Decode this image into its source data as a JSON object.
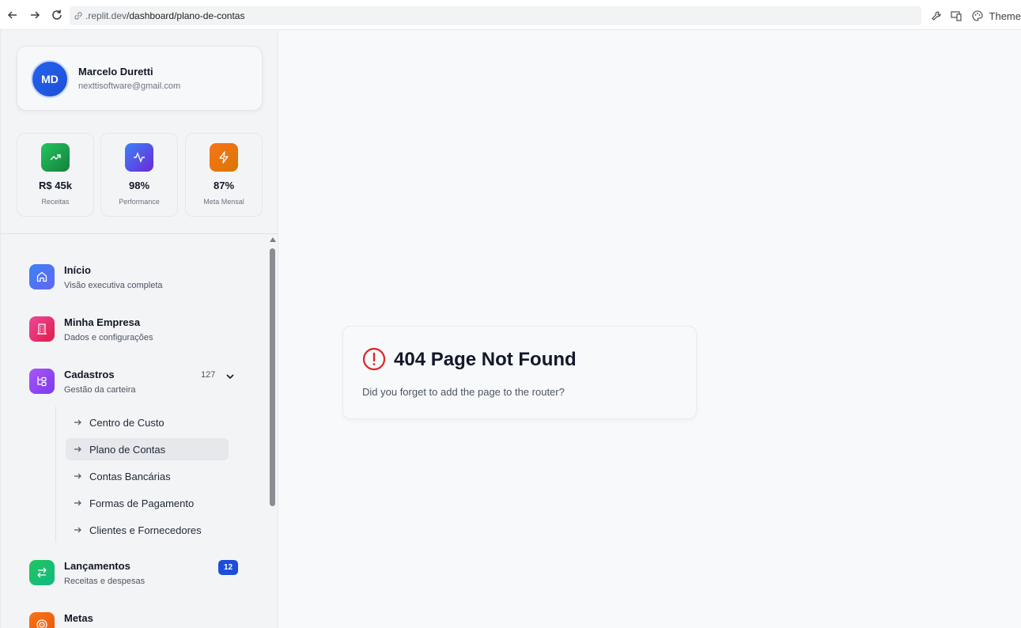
{
  "browser": {
    "url_domain": ".replit.dev",
    "url_path": "/dashboard/plano-de-contas",
    "theme_label": "Theme"
  },
  "profile": {
    "initials": "MD",
    "name": "Marcelo Duretti",
    "email": "nexttisoftware@gmail.com"
  },
  "stats": [
    {
      "value": "R$ 45k",
      "label": "Receitas",
      "icon": "trending-up-icon",
      "color": "#16a34a"
    },
    {
      "value": "98%",
      "label": "Performance",
      "icon": "activity-icon",
      "color": "#4f46e5"
    },
    {
      "value": "87%",
      "label": "Meta Mensal",
      "icon": "zap-icon",
      "color": "#ea580c"
    }
  ],
  "menu": {
    "inicio": {
      "title": "Início",
      "subtitle": "Visão executiva completa",
      "icon": "home-icon",
      "color": "#3b82f6"
    },
    "empresa": {
      "title": "Minha Empresa",
      "subtitle": "Dados e configurações",
      "icon": "building-icon",
      "color": "#ec4899"
    },
    "cadastros": {
      "title": "Cadastros",
      "subtitle": "Gestão da carteira",
      "count": "127",
      "icon": "tree-icon",
      "color": "#a855f7"
    },
    "lancamentos": {
      "title": "Lançamentos",
      "subtitle": "Receitas e despesas",
      "badge": "12",
      "icon": "swap-icon",
      "color": "#22c55e"
    },
    "metas": {
      "title": "Metas",
      "icon": "target-icon",
      "color": "#f97316"
    }
  },
  "submenu": [
    {
      "label": "Centro de Custo"
    },
    {
      "label": "Plano de Contas",
      "active": true
    },
    {
      "label": "Contas Bancárias"
    },
    {
      "label": "Formas de Pagamento"
    },
    {
      "label": "Clientes e Fornecedores"
    }
  ],
  "error": {
    "title": "404 Page Not Found",
    "message": "Did you forget to add the page to the router?",
    "color": "#dc2626"
  }
}
